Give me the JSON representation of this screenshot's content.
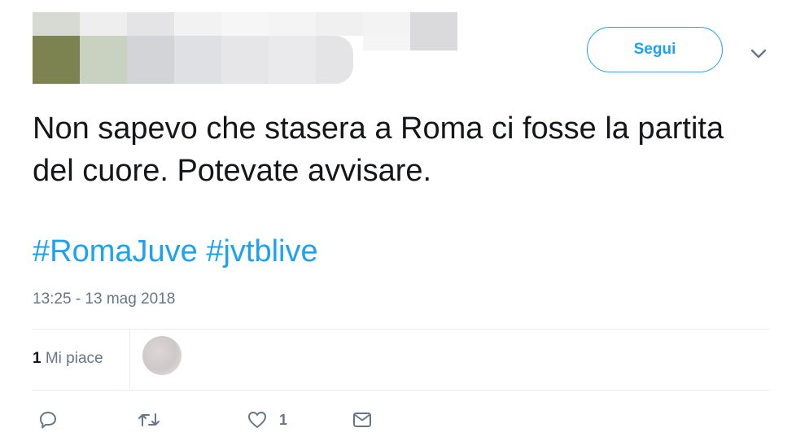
{
  "header": {
    "follow_label": "Segui",
    "more_icon": "chevron-down-icon"
  },
  "tweet": {
    "text": "Non sapevo che stasera a Roma ci fosse la partita del cuore. Potevate avvisare.",
    "hashtags": [
      "#RomaJuve",
      "#jvtblive"
    ],
    "timestamp": "13:25 - 13 mag 2018"
  },
  "stats": {
    "likes_count": "1",
    "likes_label": "Mi piace"
  },
  "actions": {
    "reply_icon": "reply-icon",
    "retweet_icon": "retweet-icon",
    "like_icon": "heart-icon",
    "like_count": "1",
    "dm_icon": "envelope-icon"
  },
  "colors": {
    "accent": "#1da1f2",
    "muted": "#657786",
    "text": "#14171a",
    "border": "#e6ecf0"
  }
}
